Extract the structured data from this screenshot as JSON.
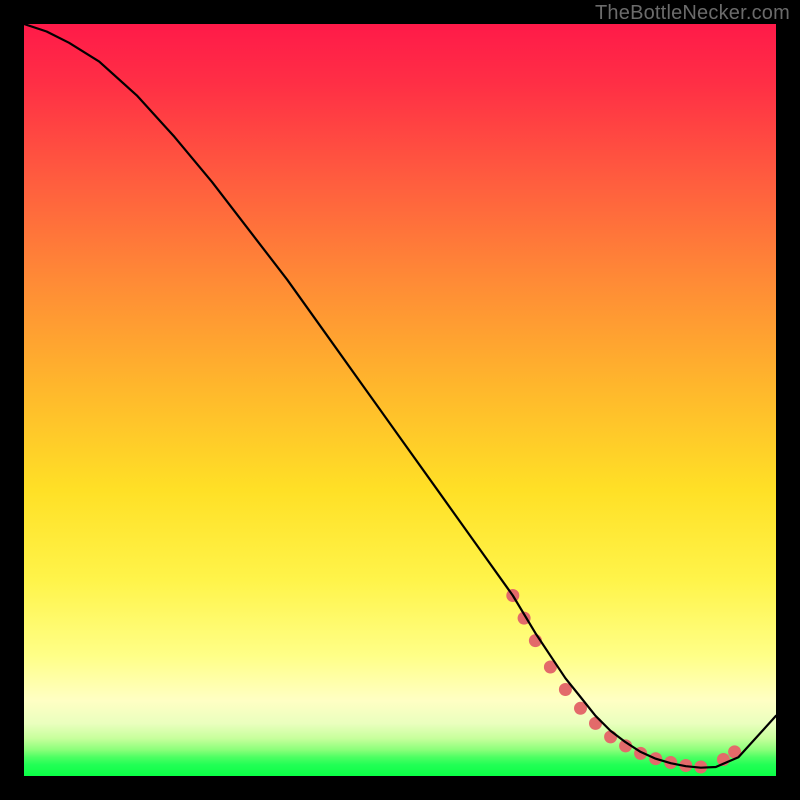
{
  "watermark": "TheBottleNecker.com",
  "chart_data": {
    "type": "line",
    "title": "",
    "xlabel": "",
    "ylabel": "",
    "xlim": [
      0,
      100
    ],
    "ylim": [
      0,
      100
    ],
    "x": [
      0,
      3,
      6,
      10,
      15,
      20,
      25,
      30,
      35,
      40,
      45,
      50,
      55,
      60,
      65,
      68,
      70,
      72,
      74,
      76,
      78,
      80,
      82,
      84,
      86,
      88,
      90,
      92,
      95,
      100
    ],
    "y": [
      100,
      99,
      97.5,
      95,
      90.5,
      85,
      79,
      72.5,
      66,
      59,
      52,
      45,
      38,
      31,
      24,
      19,
      16,
      13,
      10.5,
      8,
      6,
      4.5,
      3.2,
      2.3,
      1.7,
      1.3,
      1.1,
      1.2,
      2.5,
      8
    ],
    "marker_points": {
      "x": [
        65,
        66.5,
        68,
        70,
        72,
        74,
        76,
        78,
        80,
        82,
        84,
        86,
        88,
        90,
        93,
        94.5
      ],
      "y": [
        24,
        21,
        18,
        14.5,
        11.5,
        9,
        7,
        5.2,
        4,
        3,
        2.3,
        1.8,
        1.4,
        1.2,
        2.2,
        3.2
      ]
    },
    "marker_color": "#e36a6a",
    "line_color": "#000000"
  }
}
